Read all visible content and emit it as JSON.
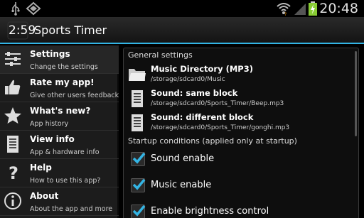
{
  "status_bar": {
    "time": "20:48",
    "icons": [
      "usb-icon",
      "app-icon",
      "wifi-icon",
      "signal-icon",
      "battery-charging-icon"
    ]
  },
  "action_bar": {
    "logo_text": "2:59",
    "title": "Sports Timer"
  },
  "colors": {
    "accent": "#33b5e5",
    "checkbox_check": "#33b5e5"
  },
  "sidebar": {
    "items": [
      {
        "title": "Settings",
        "subtitle": "Change the settings",
        "icon": "sliders-icon"
      },
      {
        "title": "Rate my app!",
        "subtitle": "Give other users feedback",
        "icon": "thumbs-up-icon"
      },
      {
        "title": "What's new?",
        "subtitle": "App history",
        "icon": "star-icon"
      },
      {
        "title": "View info",
        "subtitle": "App & hardware info",
        "icon": "document-icon"
      },
      {
        "title": "Help",
        "subtitle": "How to use this app?",
        "icon": "question-icon"
      },
      {
        "title": "About",
        "subtitle": "About the app and more",
        "icon": "info-icon"
      }
    ]
  },
  "main": {
    "general_header": "General settings",
    "prefs": [
      {
        "title": "Music Directory (MP3)",
        "value": "/storage/sdcard0/Music",
        "icon": "folder-icon"
      },
      {
        "title": "Sound: same block",
        "value": "/storage/sdcard0/Sports_Timer/Beep.mp3",
        "icon": "file-icon"
      },
      {
        "title": "Sound: different block",
        "value": "/storage/sdcard0/Sports_Timer/gonghi.mp3",
        "icon": "file-icon"
      }
    ],
    "startup_header": "Startup conditions (applied only at startup)",
    "checks": [
      {
        "label": "Sound enable",
        "checked": true
      },
      {
        "label": "Music enable",
        "checked": true
      },
      {
        "label": "Enable brightness control",
        "checked": true
      }
    ]
  }
}
